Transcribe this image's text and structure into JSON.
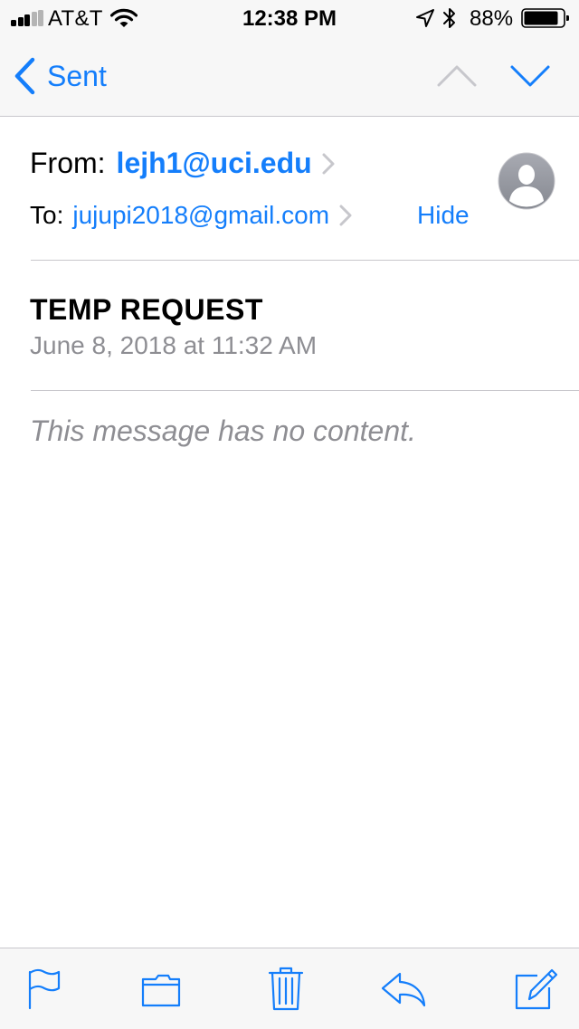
{
  "status_bar": {
    "carrier": "AT&T",
    "time": "12:38 PM",
    "battery_percent": "88%",
    "battery_level": 0.88,
    "signal_bars": 3,
    "signal_total": 5,
    "icons": [
      "cellular-signal-icon",
      "wifi-icon",
      "location-arrow-icon",
      "bluetooth-icon",
      "battery-icon"
    ]
  },
  "nav": {
    "back_label": "Sent",
    "icons": [
      "chevron-left-icon",
      "chevron-up-icon",
      "chevron-down-icon"
    ]
  },
  "header": {
    "from_label": "From:",
    "from_address": "lejh1@uci.edu",
    "to_label": "To:",
    "to_address": "jujupi2018@gmail.com",
    "hide_label": "Hide",
    "avatar_icon": "person-icon"
  },
  "message": {
    "subject": "TEMP REQUEST",
    "date": "June 8, 2018 at 11:32 AM",
    "body_placeholder": "This message has no content."
  },
  "toolbar": {
    "icons": [
      "flag-icon",
      "folder-icon",
      "trash-icon",
      "reply-icon",
      "compose-icon"
    ]
  },
  "colors": {
    "accent": "#147efb",
    "secondary_text": "#8e8e93",
    "separator": "#c8c7cc",
    "bar_background": "#f7f7f7",
    "disabled": "#c7c7cc"
  }
}
